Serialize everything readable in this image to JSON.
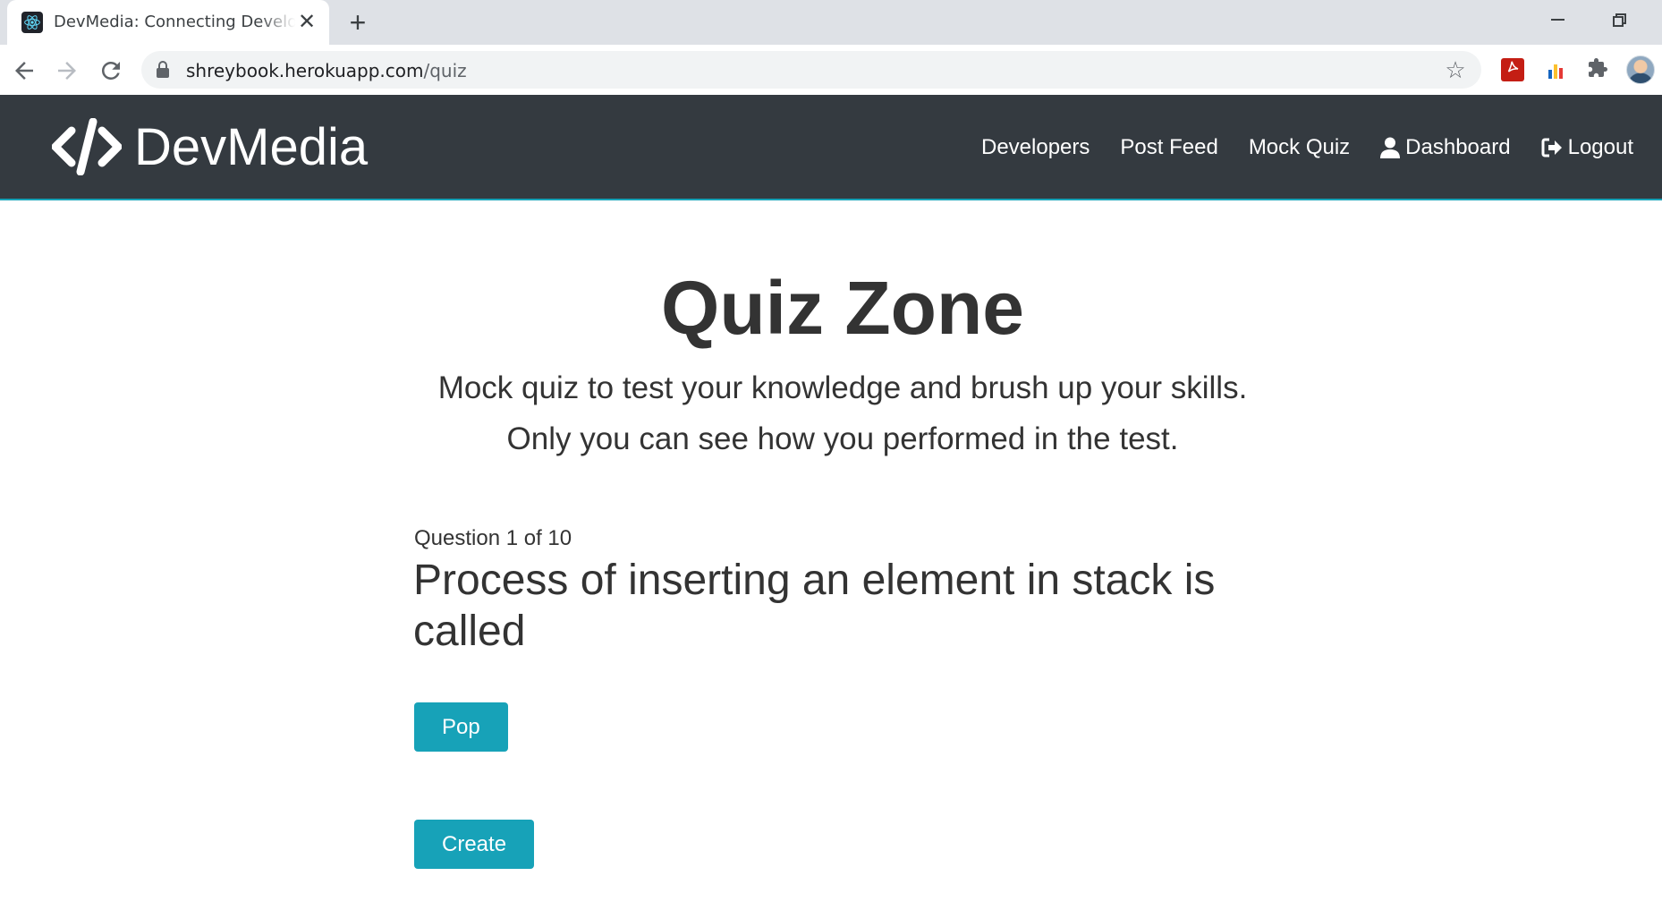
{
  "browser": {
    "tab_title": "DevMedia: Connecting Developers",
    "tab_close": "✕",
    "new_tab": "+",
    "url_host": "shreybook.herokuapp.com",
    "url_path": "/quiz"
  },
  "navbar": {
    "brand": "DevMedia",
    "links": [
      {
        "label": "Developers",
        "icon": ""
      },
      {
        "label": "Post Feed",
        "icon": ""
      },
      {
        "label": "Mock Quiz",
        "icon": ""
      },
      {
        "label": "Dashboard",
        "icon": "user-icon"
      },
      {
        "label": "Logout",
        "icon": "sign-out-icon"
      }
    ]
  },
  "main": {
    "title": "Quiz Zone",
    "lead_1": "Mock quiz to test your knowledge and brush up your skills.",
    "lead_2": "Only you can see how you performed in the test.",
    "question_counter": "Question 1 of 10",
    "question": "Process of inserting an element in stack is called",
    "options": [
      "Pop",
      "Create"
    ]
  },
  "colors": {
    "navbar_bg": "#343a40",
    "accent": "#17a2b8",
    "text": "#333333"
  }
}
